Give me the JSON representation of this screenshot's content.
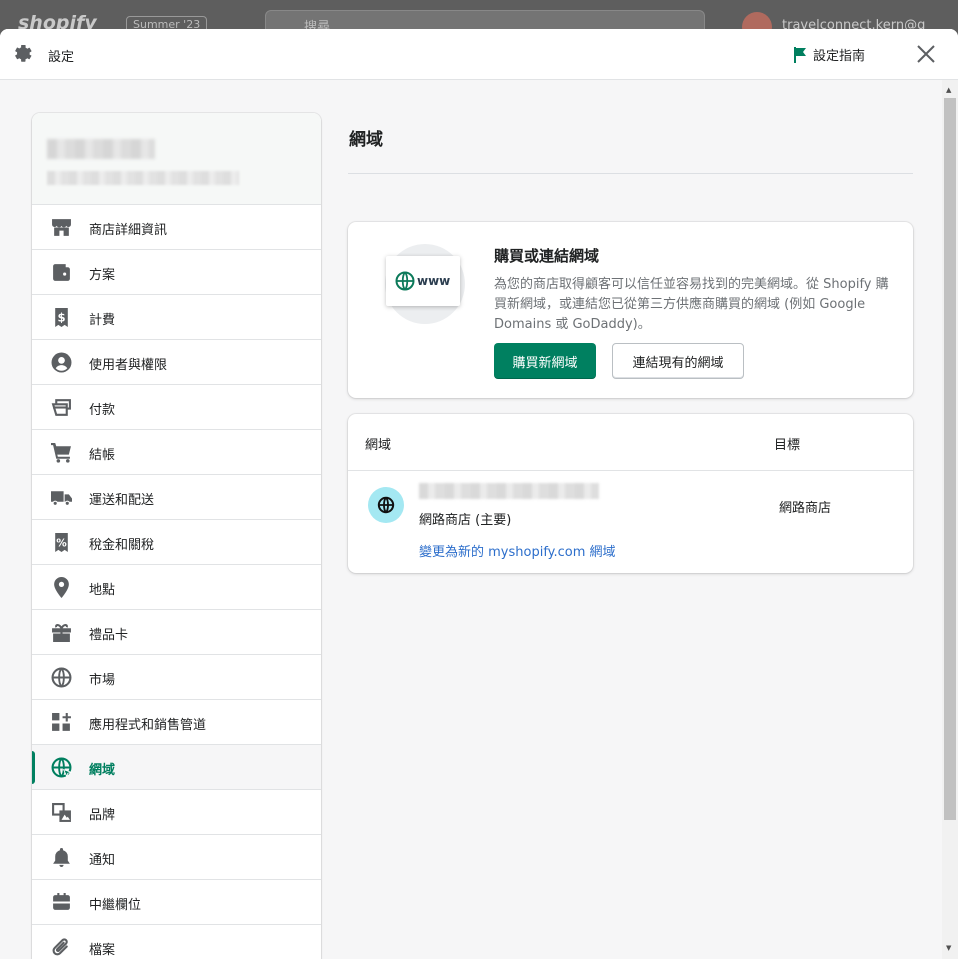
{
  "background": {
    "logo": "shopify",
    "plan_badge": "Summer '23",
    "search_placeholder": "搜尋",
    "user": "travelconnect.kern@g"
  },
  "header": {
    "title": "設定",
    "guide_label": "設定指南",
    "icons": {
      "settings": "gear-icon",
      "guide": "flag-icon",
      "close": "close-icon"
    }
  },
  "sidebar": {
    "items": [
      {
        "label": "商店詳細資訊",
        "icon": "store-icon"
      },
      {
        "label": "方案",
        "icon": "plan-icon"
      },
      {
        "label": "計費",
        "icon": "billing-icon"
      },
      {
        "label": "使用者與權限",
        "icon": "user-icon"
      },
      {
        "label": "付款",
        "icon": "payments-icon"
      },
      {
        "label": "結帳",
        "icon": "cart-icon"
      },
      {
        "label": "運送和配送",
        "icon": "truck-icon"
      },
      {
        "label": "稅金和關稅",
        "icon": "tax-icon"
      },
      {
        "label": "地點",
        "icon": "location-icon"
      },
      {
        "label": "禮品卡",
        "icon": "gift-icon"
      },
      {
        "label": "市場",
        "icon": "markets-globe-icon"
      },
      {
        "label": "應用程式和銷售管道",
        "icon": "apps-icon"
      },
      {
        "label": "網域",
        "icon": "domains-globe-icon",
        "active": true
      },
      {
        "label": "品牌",
        "icon": "brand-icon"
      },
      {
        "label": "通知",
        "icon": "bell-icon"
      },
      {
        "label": "中繼欄位",
        "icon": "metafields-icon"
      },
      {
        "label": "檔案",
        "icon": "paperclip-icon"
      }
    ]
  },
  "main": {
    "title": "網域",
    "promo": {
      "illustration_text": "www",
      "title": "購買或連結網域",
      "description": "為您的商店取得顧客可以信任並容易找到的完美網域。從 Shopify 購買新網域，或連結您已從第三方供應商購買的網域 (例如 Google Domains 或 GoDaddy)。",
      "primary_label": "購買新網域",
      "secondary_label": "連結現有的網域"
    },
    "table": {
      "col_domain": "網域",
      "col_target": "目標",
      "rows": [
        {
          "subtitle": "網路商店 (主要)",
          "target": "網路商店",
          "link": "變更為新的 myshopify.com 網域"
        }
      ]
    }
  },
  "colors": {
    "accent": "#008060",
    "link": "#2c6ecb",
    "badge": "#a4e8f2"
  }
}
